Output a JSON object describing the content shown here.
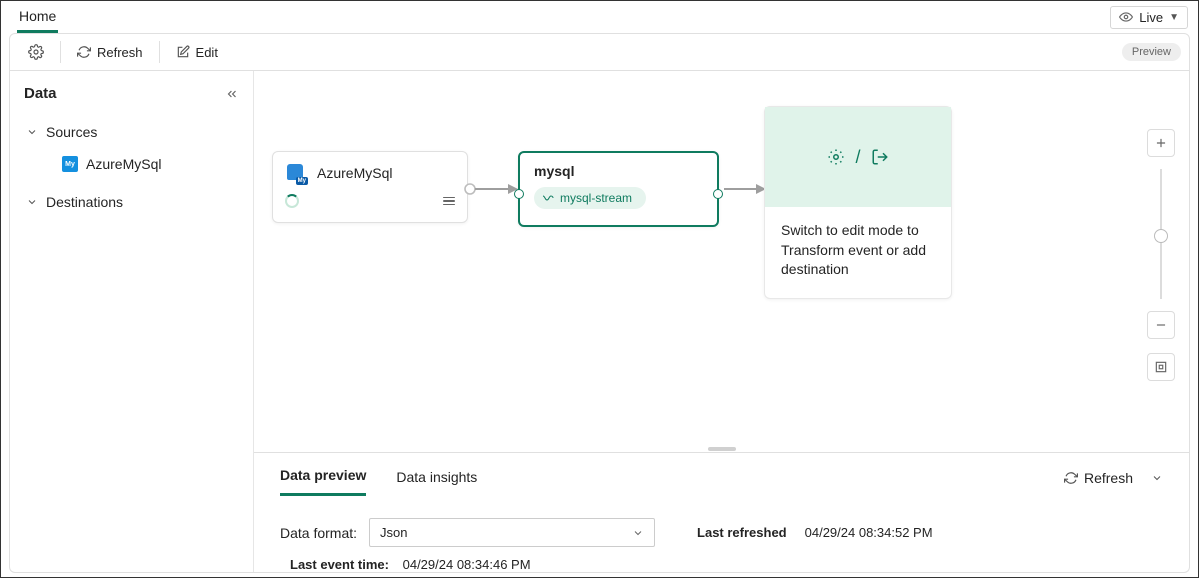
{
  "header": {
    "tab": "Home",
    "live_label": "Live"
  },
  "toolbar": {
    "refresh": "Refresh",
    "edit": "Edit",
    "preview_chip": "Preview"
  },
  "sidebar": {
    "title": "Data",
    "sources_label": "Sources",
    "destinations_label": "Destinations",
    "sources": [
      {
        "label": "AzureMySql"
      }
    ]
  },
  "canvas": {
    "source_node": {
      "title": "AzureMySql"
    },
    "stream_node": {
      "title": "mysql",
      "pill": "mysql-stream"
    },
    "dest_node": {
      "separator": "/",
      "hint": "Switch to edit mode to Transform event or add destination"
    }
  },
  "preview": {
    "tab_preview": "Data preview",
    "tab_insights": "Data insights",
    "refresh": "Refresh",
    "format_label": "Data format:",
    "format_value": "Json",
    "last_refreshed_label": "Last refreshed",
    "last_refreshed_value": "04/29/24 08:34:52 PM",
    "last_event_label": "Last event time:",
    "last_event_value": "04/29/24 08:34:46 PM"
  }
}
